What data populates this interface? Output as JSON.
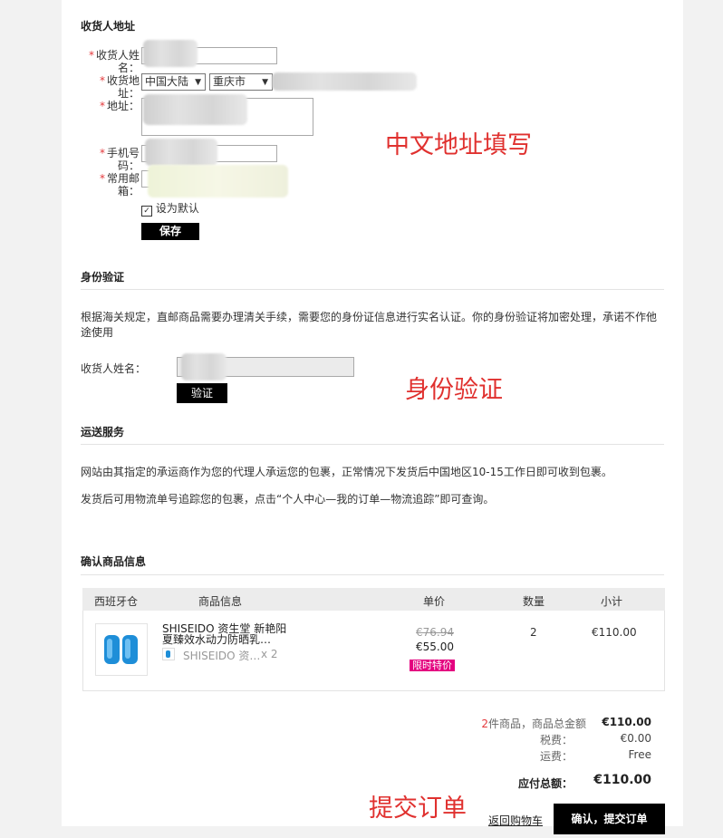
{
  "address": {
    "section_title": "收货人地址",
    "name_label": "收货人姓名：",
    "region_label": "收货地址：",
    "country_select": "中国大陆",
    "city_select": "重庆市",
    "detail_label": "地址：",
    "phone_label": "手机号码：",
    "email_label": "常用邮箱：",
    "default_checkbox_label": "设为默认",
    "save_button": "保存",
    "annotation": "中文地址填写"
  },
  "identity": {
    "section_title": "身份验证",
    "description": "根据海关规定，直邮商品需要办理清关手续，需要您的身份证信息进行实名认证。你的身份验证将加密处理，承诺不作他途使用",
    "name_label": "收货人姓名：",
    "verify_button": "验证",
    "annotation": "身份验证"
  },
  "shipping": {
    "section_title": "运送服务",
    "line1": "网站由其指定的承运商作为您的代理人承运您的包裹，正常情况下发货后中国地区10-15工作日即可收到包裹。",
    "line2": "发货后可用物流单号追踪您的包裹，点击“个人中心—我的订单—物流追踪”即可查询。"
  },
  "confirm": {
    "section_title": "确认商品信息",
    "headers": {
      "store": "西班牙仓",
      "info": "商品信息",
      "price": "单价",
      "qty": "数量",
      "subtotal": "小计"
    },
    "product": {
      "title": "SHISEIDO 资生堂 新艳阳夏臻效水动力防晒乳…",
      "sub_name": "SHISEIDO 资…",
      "sub_qty": "x 2",
      "original_price": "€76.94",
      "price": "€55.00",
      "badge": "限时特价",
      "qty": "2",
      "subtotal": "€110.00"
    }
  },
  "summary": {
    "count": "2",
    "count_label": "件商品，商品总金额",
    "goods_total": "€110.00",
    "tax_label": "税费：",
    "tax": "€0.00",
    "shipping_label": "运费：",
    "shipping": "Free",
    "total_label": "应付总额：",
    "total": "€110.00"
  },
  "footer": {
    "annotation": "提交订单",
    "back_link": "返回购物车",
    "submit_button": "确认，提交订单"
  },
  "colors": {
    "accent_red": "#e0312f",
    "badge_pink": "#e4007f",
    "button_black": "#000000"
  }
}
